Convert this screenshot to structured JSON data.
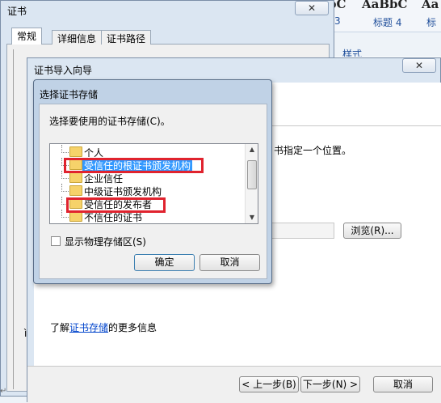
{
  "ribbon": {
    "styles": [
      {
        "preview": "bC",
        "name": "3"
      },
      {
        "preview": "AaBbC",
        "name": "标题 4"
      },
      {
        "preview": "Aa",
        "name": "标"
      }
    ],
    "style_link": "样式"
  },
  "cert_window": {
    "title": "证书",
    "close_glyph": "✕",
    "tabs": [
      "常规",
      "详细信息",
      "证书路径"
    ],
    "side_letter": "ì"
  },
  "wizard": {
    "title": "证书导入向导",
    "close_glyph": "✕",
    "description_tail": "书指定一个位置。",
    "browse_button": "浏览(R)...",
    "learn_prefix": "了解",
    "learn_link": "证书存储",
    "learn_suffix": "的更多信息",
    "back_button": "< 上一步(B)",
    "next_button": "下一步(N) >",
    "cancel_button": "取消"
  },
  "store_dialog": {
    "title": "选择证书存储",
    "prompt": "选择要使用的证书存储(C)。",
    "stores": [
      {
        "label": "个人",
        "selected": false
      },
      {
        "label": "受信任的根证书颁发机构",
        "selected": true
      },
      {
        "label": "企业信任",
        "selected": false
      },
      {
        "label": "中级证书颁发机构",
        "selected": false
      },
      {
        "label": "受信任的发布者",
        "selected": false
      },
      {
        "label": "不信任的证书",
        "selected": false
      }
    ],
    "show_physical_label": "显示物理存储区(S)",
    "show_physical_checked": false,
    "ok_button": "确定",
    "cancel_button": "取消",
    "scroll_up_glyph": "▲",
    "scroll_down_glyph": "▼"
  },
  "colors": {
    "highlight": "#e0232e",
    "selection": "#3399ff",
    "link": "#0044cc"
  }
}
